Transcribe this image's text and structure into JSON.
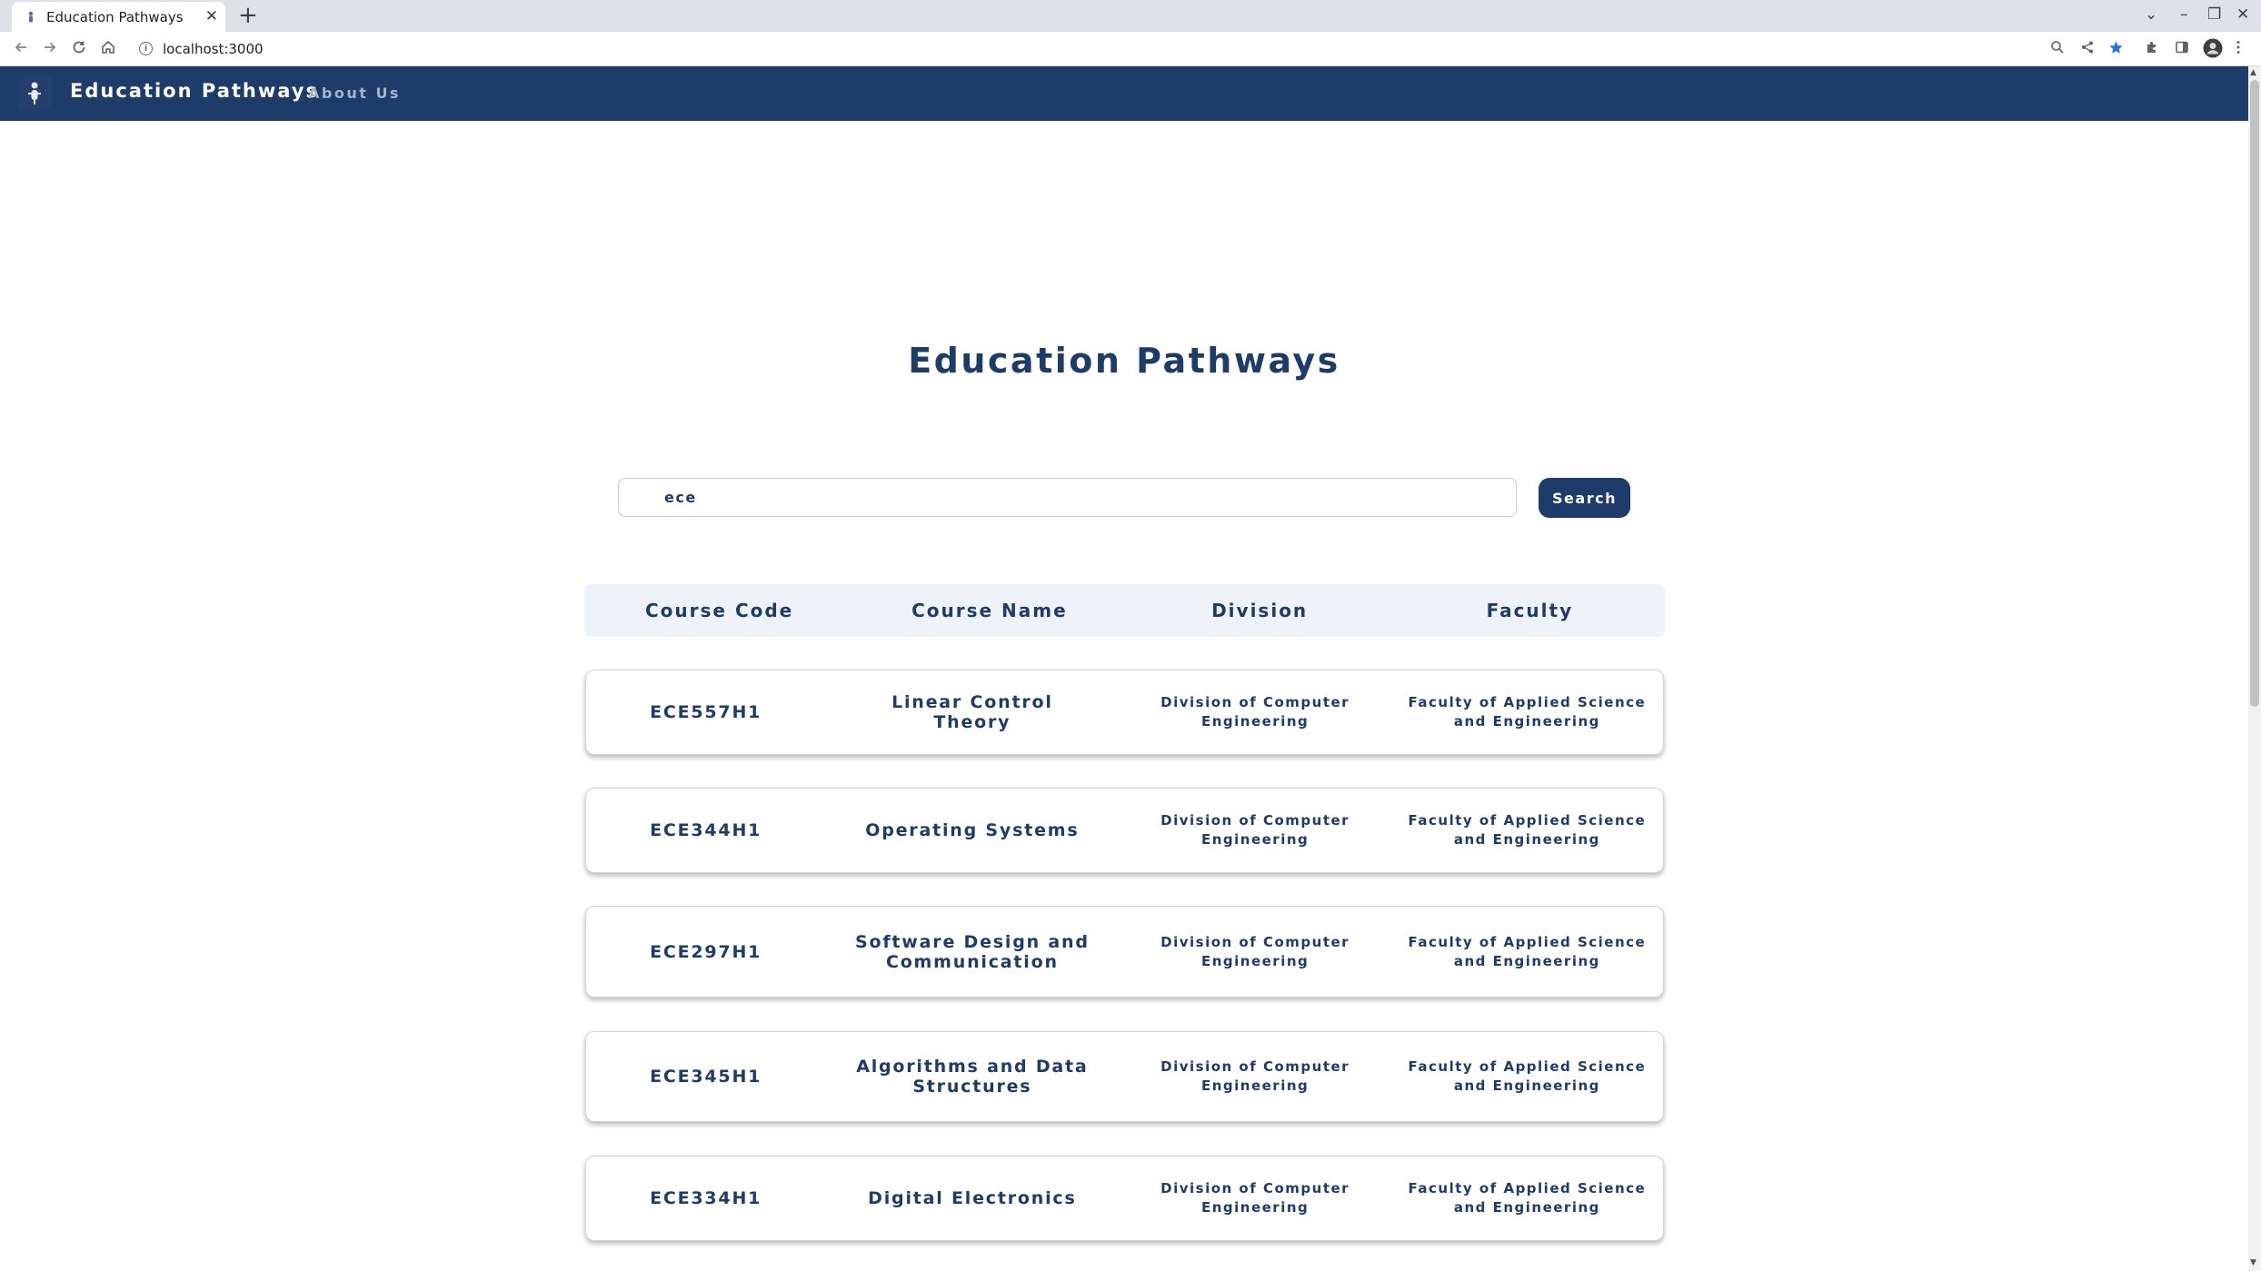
{
  "browser": {
    "tab_title": "Education Pathways",
    "tab_close": "✕",
    "new_tab": "+",
    "url": "localhost:3000",
    "window_controls": [
      "⌄",
      "–",
      "❐",
      "✕"
    ]
  },
  "header": {
    "brand": "Education Pathways",
    "nav_about": "About Us"
  },
  "main": {
    "title": "Education Pathways",
    "search": {
      "value": "ece",
      "button_label": "Search"
    },
    "table": {
      "headers": [
        "Course Code",
        "Course Name",
        "Division",
        "Faculty"
      ],
      "rows": [
        {
          "code": "ECE557H1",
          "name": "Linear Control Theory",
          "division": "Division of Computer Engineering",
          "faculty": "Faculty of Applied Science and Engineering"
        },
        {
          "code": "ECE344H1",
          "name": "Operating Systems",
          "division": "Division of Computer Engineering",
          "faculty": "Faculty of Applied Science and Engineering"
        },
        {
          "code": "ECE297H1",
          "name": "Software Design and Communication",
          "division": "Division of Computer Engineering",
          "faculty": "Faculty of Applied Science and Engineering"
        },
        {
          "code": "ECE345H1",
          "name": "Algorithms and Data Structures",
          "division": "Division of Computer Engineering",
          "faculty": "Faculty of Applied Science and Engineering"
        },
        {
          "code": "ECE334H1",
          "name": "Digital Electronics",
          "division": "Division of Computer Engineering",
          "faculty": "Faculty of Applied Science and Engineering"
        }
      ]
    }
  },
  "colors": {
    "brand_navy": "#1d3c6a",
    "header_row_bg": "#eef3fa",
    "nav_link": "#a7b4c8"
  },
  "icons": [
    "back-arrow-icon",
    "forward-arrow-icon",
    "reload-icon",
    "home-icon",
    "info-icon",
    "zoom-icon",
    "share-icon",
    "bookmark-star-icon",
    "extensions-icon",
    "sidepanel-icon",
    "profile-avatar-icon",
    "menu-dots-icon",
    "logo-icon"
  ]
}
